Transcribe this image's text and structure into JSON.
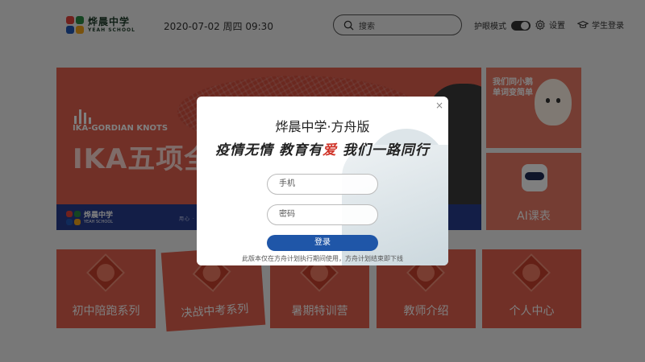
{
  "header": {
    "logo_cn": "烨晨中学",
    "logo_en": "YEAH SCHOOL",
    "datetime": "2020-07-02 周四 09:30",
    "search_placeholder": "搜索",
    "eye_mode_label": "护眼模式",
    "settings_label": "设置",
    "student_login_label": "学生登录"
  },
  "colors": {
    "logo": [
      "#e0433a",
      "#2b8b45",
      "#2157b5",
      "#f2a51b"
    ],
    "accent": "#e2604e",
    "login_button": "#1f56a8"
  },
  "banner": {
    "subtitle": "IKA-GORDIAN KNOTS",
    "title": "IKA五项全",
    "foot_logo_cn": "烨晨中学",
    "foot_logo_en": "YEAH SCHOOL",
    "foot_motto": "用心 · 真爱 · 真教育    SINCERENESS"
  },
  "side_cards": [
    {
      "text": "我们同小鹅单词变简单"
    },
    {
      "text": "AI课表"
    }
  ],
  "categories": [
    {
      "label": "初中陪跑系列"
    },
    {
      "label": "决战中考系列"
    },
    {
      "label": "暑期特训营"
    },
    {
      "label": "教师介绍"
    },
    {
      "label": "个人中心"
    }
  ],
  "modal": {
    "close": "×",
    "title": "烨晨中学·方舟版",
    "slogan_part1": "疫情无情  教育有",
    "slogan_heart": "爱",
    "slogan_part2": "  我们一路同行",
    "phone_placeholder": "手机",
    "password_placeholder": "密码",
    "login_button": "登录",
    "note": "此版本仅在方舟计划执行期间使用，方舟计划结束即下线"
  }
}
